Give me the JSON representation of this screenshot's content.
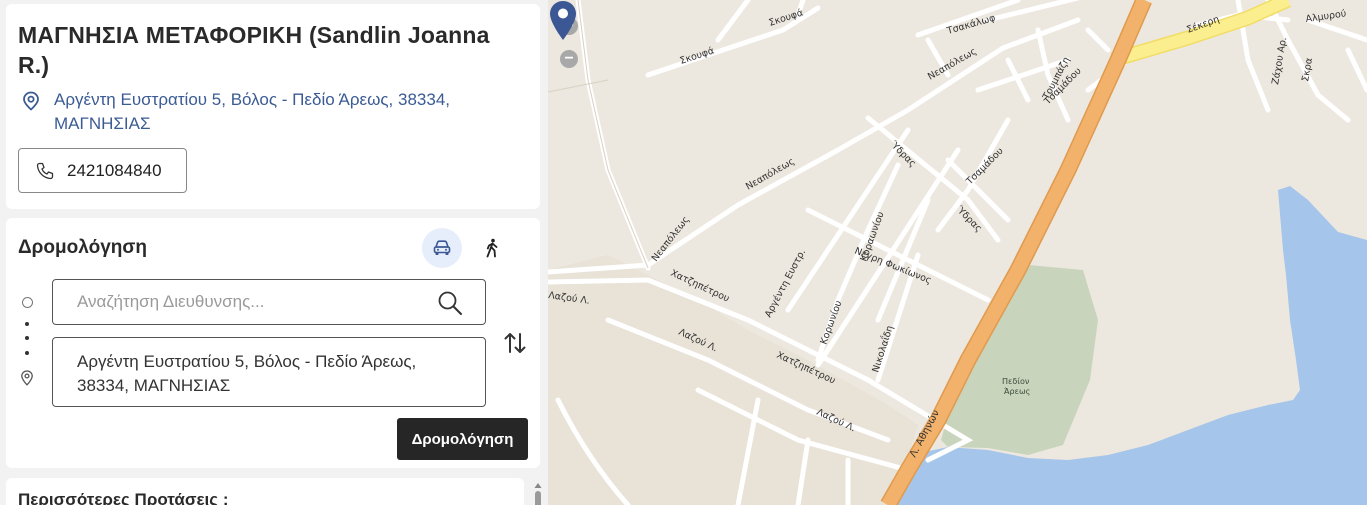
{
  "business": {
    "name": "ΜΑΓΝΗΣΙΑ ΜΕΤΑΦΟΡΙΚΗ (Sandlin Joanna R.)",
    "address": "Αργέντη Ευστρατίου 5, Βόλος - Πεδίο Άρεως, 38334, ΜΑΓΝΗΣΙΑΣ",
    "phone": "2421084840"
  },
  "routing": {
    "title": "Δρομολόγηση",
    "origin_placeholder": "Αναζήτηση Διευθυνσης...",
    "destination": "Αργέντη Ευστρατίου 5, Βόλος - Πεδίο Άρεως, 38334, ΜΑΓΝΗΣΙΑΣ",
    "button_label": "Δρομολόγηση",
    "modes": [
      "car-icon",
      "walk-icon"
    ],
    "active_mode": "car"
  },
  "more": {
    "title": "Περισσότερες Προτάσεις :"
  },
  "map": {
    "zoom_in": "+",
    "zoom_out": "−",
    "streets": {
      "skoufa1": "Σκουφά",
      "skoufa2": "Σκουφά",
      "tsakalof": "Τσακάλωφ",
      "neapoleos1": "Νεαπόλεως",
      "neapoleos2": "Νεαπόλεως",
      "neapoleos3": "Νεαπόλεως",
      "toumpa": "Τουμπάζη",
      "tsamadou1": "Τσαμάδου",
      "tsamadou2": "Τσαμάδου",
      "ydras1": "Ύδρας",
      "ydras2": "Ύδρας",
      "sekeri": "Σέκερη",
      "almyrou": "Αλμυρού",
      "zachou": "Ζάχου Αρ.",
      "skra": "Σκρα",
      "argenti": "Αργέντη Ευστρ.",
      "kronioiou1": "Κοραωνίου",
      "kronioiou2": "Κορωνίου",
      "negri": "Νέγρη Φωκίωνος",
      "nikolaidi": "Νικολαΐδη",
      "chatzipetrou1": "Χατζηπέτρου",
      "chatzipetrou2": "Χατζηπέτρου",
      "lazou1": "Λαζού Λ.",
      "lazou2": "Λαζού Λ.",
      "lazou3": "Λαζού Λ.",
      "athinon": "Λ. Αθηνών",
      "pedion": "Πεδίον",
      "areos": "Άρεως"
    },
    "colors": {
      "land": "#ede8df",
      "block": "#e6dfd2",
      "road": "#ffffff",
      "highway": "#f2b26b",
      "secondary": "#fbee8f",
      "water": "#a5c6ea",
      "park": "#c9d4bd",
      "pin": "#3b5794"
    }
  }
}
